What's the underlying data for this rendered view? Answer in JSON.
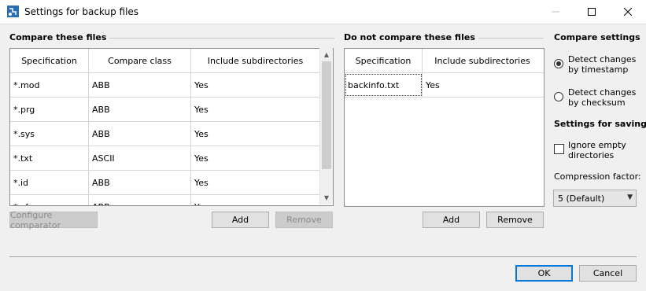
{
  "window": {
    "title": "Settings for backup files"
  },
  "compare_group": {
    "title": "Compare these files",
    "headers": [
      "Specification",
      "Compare class",
      "Include subdirectories"
    ],
    "rows": [
      [
        "*.mod",
        "ABB",
        "Yes"
      ],
      [
        "*.prg",
        "ABB",
        "Yes"
      ],
      [
        "*.sys",
        "ABB",
        "Yes"
      ],
      [
        "*.txt",
        "ASCII",
        "Yes"
      ],
      [
        "*.id",
        "ABB",
        "Yes"
      ],
      [
        "*.cfg",
        "ABB",
        "Yes"
      ]
    ],
    "configure_label": "Configure comparator",
    "add_label": "Add",
    "remove_label": "Remove"
  },
  "exclude_group": {
    "title": "Do not compare these files",
    "headers": [
      "Specification",
      "Include subdirectories"
    ],
    "rows": [
      [
        "backinfo.txt",
        "Yes"
      ]
    ],
    "add_label": "Add",
    "remove_label": "Remove"
  },
  "compare_settings": {
    "title": "Compare settings",
    "options": [
      {
        "line1": "Detect changes",
        "line2": "by timestamp",
        "checked": true
      },
      {
        "line1": "Detect changes",
        "line2": "by checksum",
        "checked": false
      }
    ]
  },
  "saving_settings": {
    "title": "Settings for saving",
    "ignore_line1": "Ignore empty",
    "ignore_line2": "directories",
    "ignore_checked": false,
    "compression_label": "Compression factor:",
    "compression_value": "5 (Default)"
  },
  "footer": {
    "ok_label": "OK",
    "cancel_label": "Cancel"
  },
  "icons": {
    "app": "backup-settings-icon",
    "minimize": "minimize-icon",
    "maximize": "maximize-icon",
    "close": "close-icon",
    "scroll_up": "chevron-up-icon",
    "scroll_down": "chevron-down-icon",
    "dropdown": "chevron-down-icon"
  },
  "colors": {
    "accent": "#0078d7",
    "app_icon": "#2a6fb5"
  }
}
